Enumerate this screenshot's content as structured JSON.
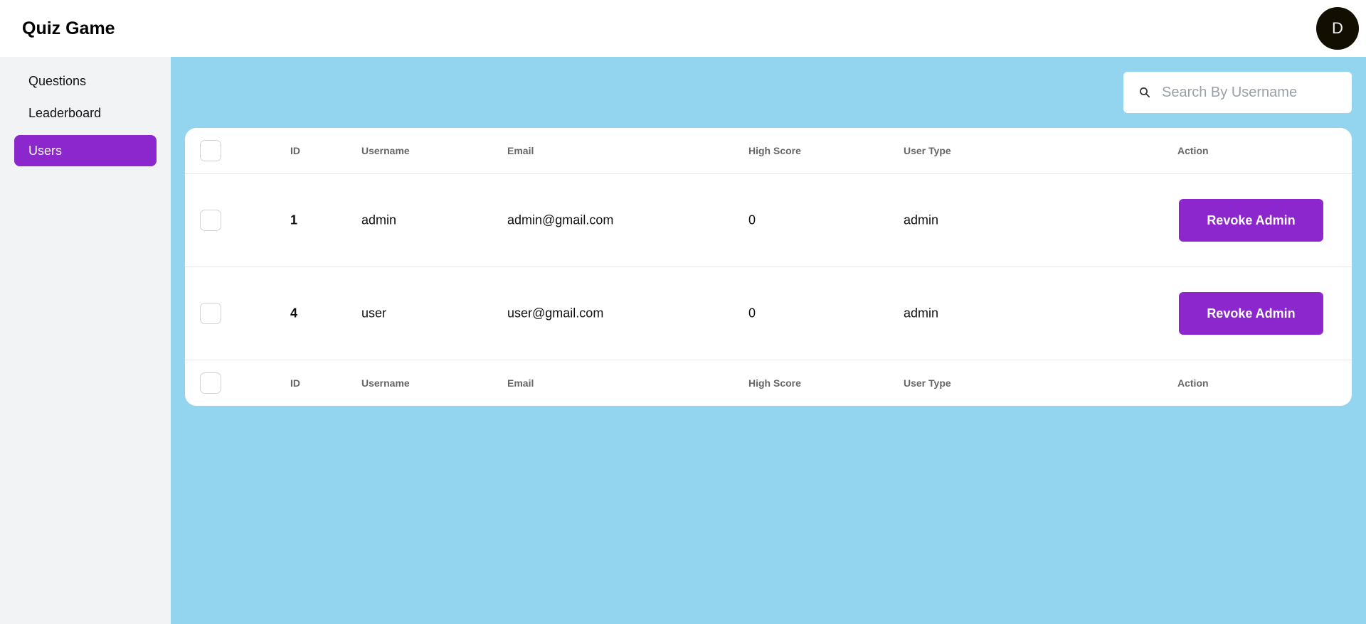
{
  "app": {
    "title": "Quiz Game"
  },
  "user": {
    "avatar_initial": "D"
  },
  "sidebar": {
    "items": [
      {
        "label": "Questions",
        "active": false
      },
      {
        "label": "Leaderboard",
        "active": false
      },
      {
        "label": "Users",
        "active": true
      }
    ]
  },
  "search": {
    "placeholder": "Search By Username",
    "value": ""
  },
  "table": {
    "columns": [
      "ID",
      "Username",
      "Email",
      "High Score",
      "User Type",
      "Action"
    ],
    "rows": [
      {
        "id": "1",
        "username": "admin",
        "email": "admin@gmail.com",
        "high_score": "0",
        "user_type": "admin",
        "action": "Revoke Admin"
      },
      {
        "id": "4",
        "username": "user",
        "email": "user@gmail.com",
        "high_score": "0",
        "user_type": "admin",
        "action": "Revoke Admin"
      }
    ]
  },
  "colors": {
    "accent": "#8b27cc",
    "main_background": "#93d4ef",
    "sidebar_background": "#f2f3f5",
    "avatar_background": "#120f02"
  }
}
